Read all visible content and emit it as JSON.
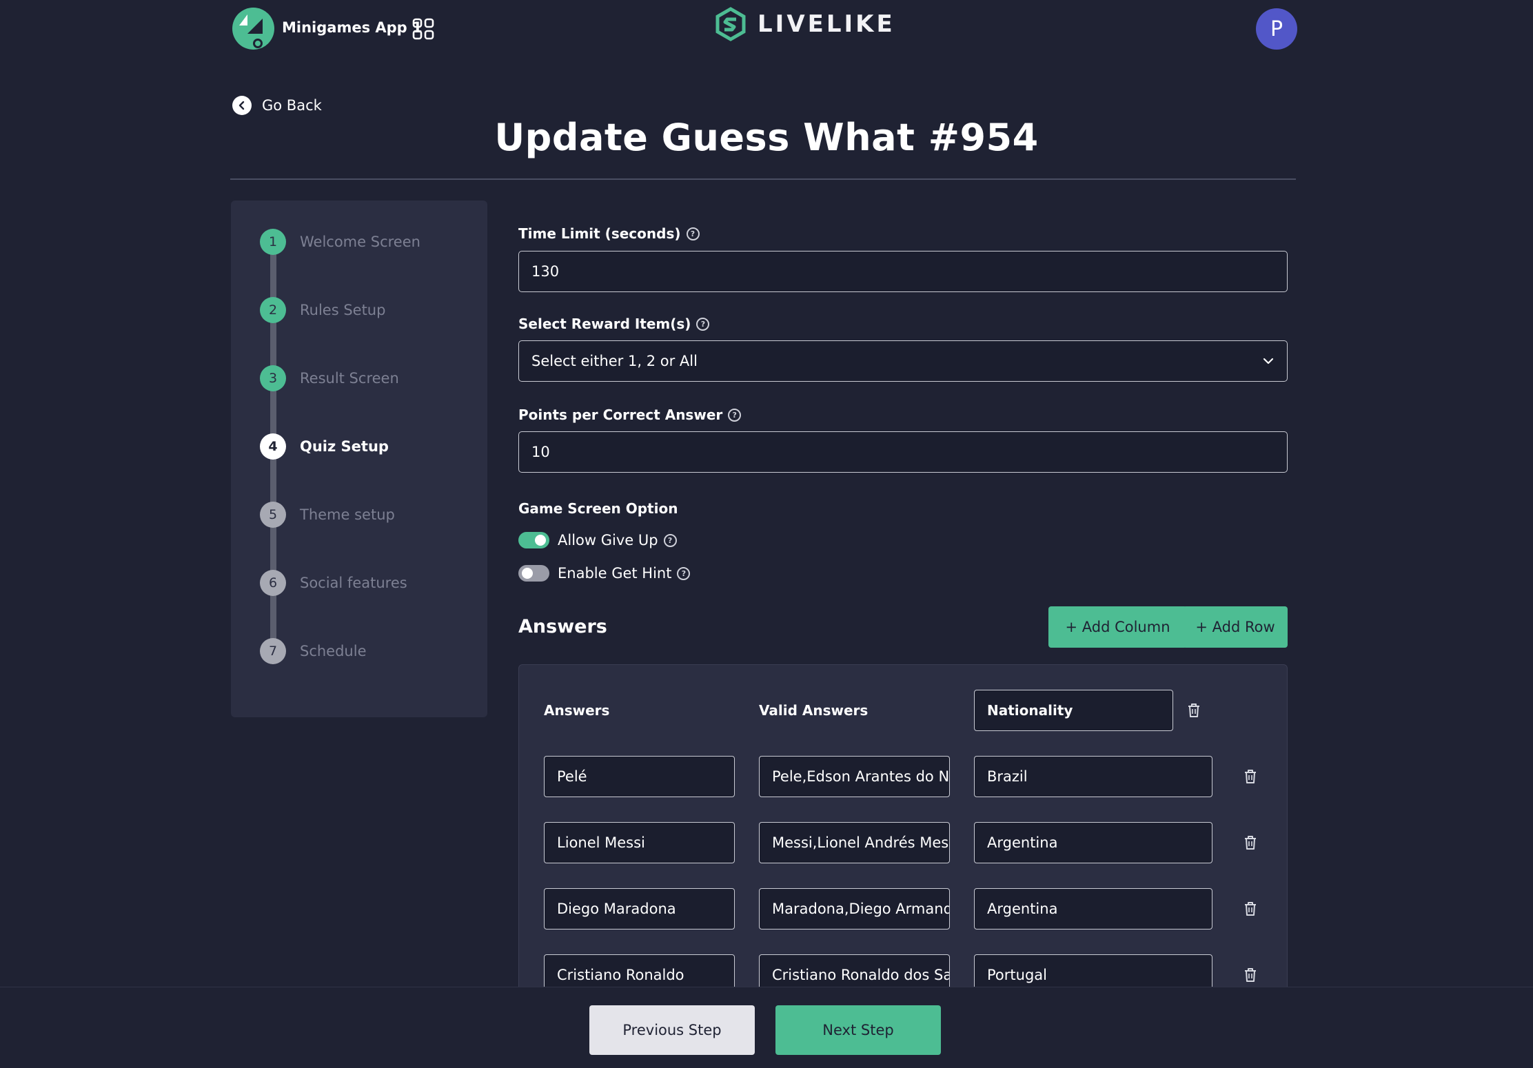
{
  "header": {
    "app_name": "Minigames App 1",
    "brand": "LIVELIKE",
    "avatar_initial": "P"
  },
  "nav": {
    "back_label": "Go Back"
  },
  "page_title": "Update Guess What #954",
  "stepper": {
    "steps": [
      {
        "number": "1",
        "label": "Welcome Screen",
        "state": "done"
      },
      {
        "number": "2",
        "label": "Rules Setup",
        "state": "done"
      },
      {
        "number": "3",
        "label": "Result Screen",
        "state": "done"
      },
      {
        "number": "4",
        "label": "Quiz Setup",
        "state": "active"
      },
      {
        "number": "5",
        "label": "Theme setup",
        "state": "todo"
      },
      {
        "number": "6",
        "label": "Social features",
        "state": "todo"
      },
      {
        "number": "7",
        "label": "Schedule",
        "state": "todo"
      }
    ]
  },
  "form": {
    "time_limit": {
      "label": "Time Limit (seconds)",
      "value": "130"
    },
    "reward": {
      "label": "Select Reward Item(s)",
      "value": "Select either 1, 2 or All"
    },
    "points": {
      "label": "Points per Correct Answer",
      "value": "10"
    },
    "game_screen": {
      "label": "Game Screen Option",
      "allow_give_up": {
        "label": "Allow Give Up",
        "enabled": true
      },
      "enable_hint": {
        "label": "Enable Get Hint",
        "enabled": false
      }
    }
  },
  "answers": {
    "title": "Answers",
    "add_column_label": "+ Add Column",
    "add_row_label": "+ Add Row",
    "columns": {
      "answers": "Answers",
      "valid_answers": "Valid Answers",
      "custom": "Nationality"
    },
    "rows": [
      {
        "answer": "Pelé",
        "valid": "Pele,Edson Arantes do Na",
        "nationality": "Brazil"
      },
      {
        "answer": "Lionel Messi",
        "valid": "Messi,Lionel Andrés Mess",
        "nationality": "Argentina"
      },
      {
        "answer": "Diego Maradona",
        "valid": "Maradona,Diego Armando",
        "nationality": "Argentina"
      },
      {
        "answer": "Cristiano Ronaldo",
        "valid": "Cristiano Ronaldo dos Sar",
        "nationality": "Portugal"
      }
    ]
  },
  "footer": {
    "previous_label": "Previous Step",
    "next_label": "Next Step"
  },
  "colors": {
    "background": "#1f2233",
    "panel": "#2b2e42",
    "accent": "#4dbd93",
    "avatar": "#5257c8"
  }
}
